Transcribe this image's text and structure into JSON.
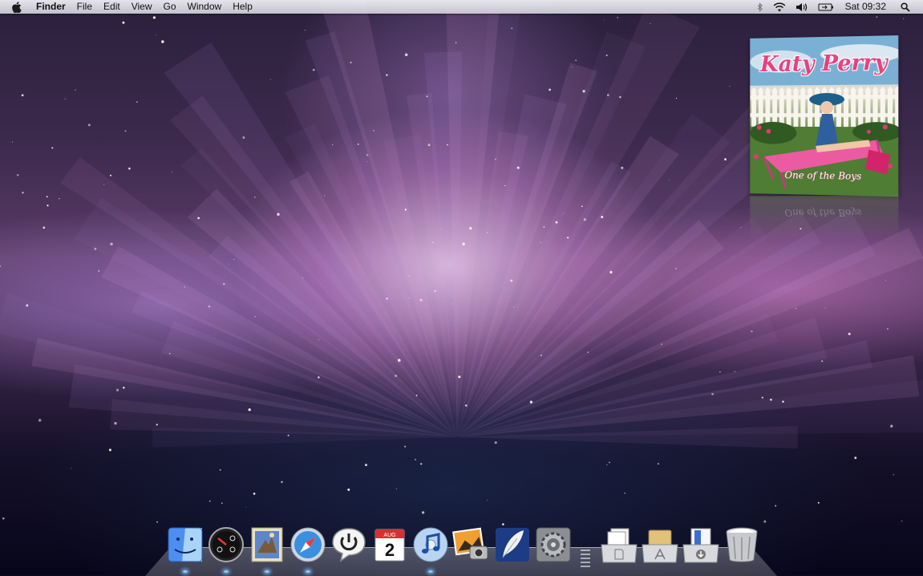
{
  "menubar": {
    "apple_icon": "apple-logo-icon",
    "app_name": "Finder",
    "items": [
      "File",
      "Edit",
      "View",
      "Go",
      "Window",
      "Help"
    ],
    "status_icons": [
      "bluetooth-icon",
      "wifi-icon",
      "volume-icon",
      "battery-icon"
    ],
    "clock": "Sat 09:32",
    "spotlight_icon": "spotlight-search-icon"
  },
  "album_widget": {
    "artist": "Katy Perry",
    "title": "One of the Boys"
  },
  "dock": {
    "apps": [
      {
        "icon": "finder-icon",
        "running": true
      },
      {
        "icon": "dashboard-icon",
        "running": true
      },
      {
        "icon": "mail-icon",
        "running": true
      },
      {
        "icon": "safari-icon",
        "running": true
      },
      {
        "icon": "chat-power-icon",
        "running": false
      },
      {
        "icon": "calendar-icon",
        "running": false,
        "month": "AUG",
        "day": "2"
      },
      {
        "icon": "itunes-icon",
        "running": true
      },
      {
        "icon": "iphoto-icon",
        "running": false
      },
      {
        "icon": "feather-app-icon",
        "running": false
      },
      {
        "icon": "system-preferences-icon",
        "running": false
      }
    ],
    "stacks": [
      {
        "icon": "documents-stack-icon"
      },
      {
        "icon": "applications-stack-icon"
      },
      {
        "icon": "downloads-stack-icon"
      },
      {
        "icon": "trash-icon"
      }
    ]
  },
  "colors": {
    "menubar": "#e6e6ee",
    "wallpaper_accent": "#d88fd6",
    "album_artist_text": "#e8417f",
    "dock_indicator": "#96d2ff"
  }
}
